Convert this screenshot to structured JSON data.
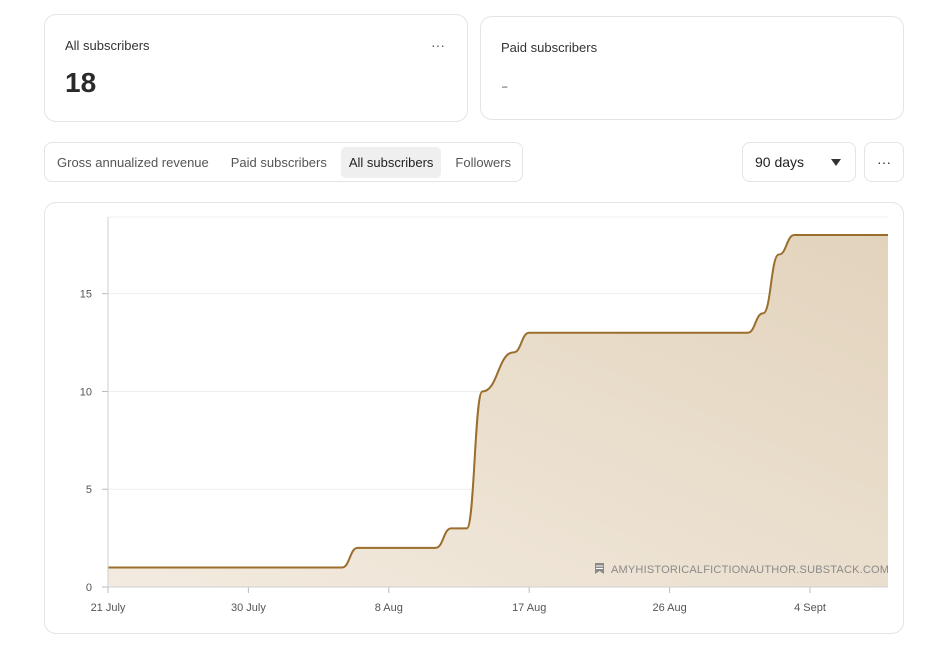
{
  "cards": {
    "all_subscribers": {
      "title": "All subscribers",
      "value": "18",
      "menu": "···"
    },
    "paid_subscribers": {
      "title": "Paid subscribers",
      "value": "-"
    }
  },
  "tabs": [
    {
      "label": "Gross annualized revenue",
      "active": false
    },
    {
      "label": "Paid subscribers",
      "active": false
    },
    {
      "label": "All subscribers",
      "active": true
    },
    {
      "label": "Followers",
      "active": false
    }
  ],
  "range_select": {
    "value": "90 days"
  },
  "more_menu": {
    "label": "···"
  },
  "watermark": {
    "text": "AMYHISTORICALFICTIONAUTHOR.SUBSTACK.COM",
    "icon": "bookmark-icon"
  },
  "colors": {
    "line": "#9a6e2c",
    "fill_top": "#e2d3bc",
    "fill_bottom": "#f3ebe0"
  },
  "chart_data": {
    "type": "area",
    "title": "",
    "xlabel": "",
    "ylabel": "",
    "ylim": [
      0,
      18
    ],
    "yticks": [
      0,
      5,
      10,
      15
    ],
    "x_tick_labels": [
      "21 July",
      "30 July",
      "8 Aug",
      "17 Aug",
      "26 Aug",
      "4 Sept"
    ],
    "x_tick_days": [
      0,
      9,
      18,
      27,
      36,
      45
    ],
    "x_range_days": [
      0,
      50
    ],
    "series": [
      {
        "values": [
          {
            "day": 0,
            "y": 1
          },
          {
            "day": 15,
            "y": 1
          },
          {
            "day": 16,
            "y": 2
          },
          {
            "day": 21,
            "y": 2
          },
          {
            "day": 22,
            "y": 3
          },
          {
            "day": 23,
            "y": 3
          },
          {
            "day": 24,
            "y": 10
          },
          {
            "day": 26,
            "y": 12
          },
          {
            "day": 27,
            "y": 13
          },
          {
            "day": 41,
            "y": 13
          },
          {
            "day": 42,
            "y": 14
          },
          {
            "day": 43,
            "y": 17
          },
          {
            "day": 44,
            "y": 18
          },
          {
            "day": 50,
            "y": 18
          }
        ]
      }
    ]
  }
}
